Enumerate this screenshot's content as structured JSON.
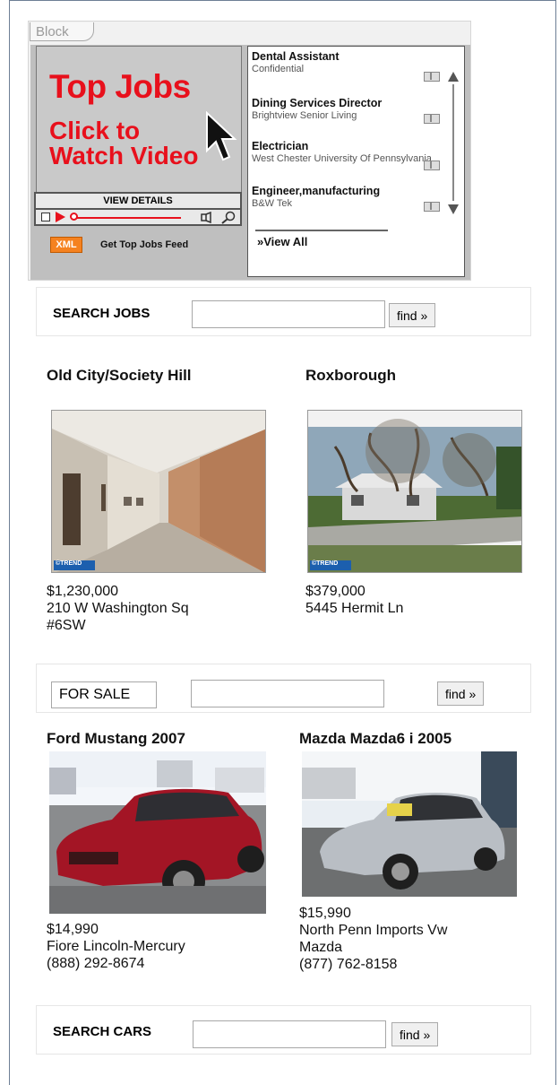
{
  "block_tab": "Block",
  "top_jobs": {
    "video_title": "Top Jobs",
    "video_subtitle_1": "Click to",
    "video_subtitle_2": "Watch Video",
    "view_details": "VIEW DETAILS",
    "xml_badge": "XML",
    "feed_label": "Get Top Jobs Feed",
    "view_all": "»View All",
    "jobs": [
      {
        "title": "Dental Assistant",
        "company": "Confidential"
      },
      {
        "title": "Dining Services Director",
        "company": "Brightview Senior Living"
      },
      {
        "title": "Electrician",
        "company": "West Chester University Of Pennsylvania"
      },
      {
        "title": "Engineer,manufacturing",
        "company": "B&W Tek"
      }
    ]
  },
  "search_jobs": {
    "label": "SEARCH JOBS",
    "value": "",
    "button": "find »"
  },
  "homes": [
    {
      "heading": "Old City/Society Hill",
      "price": "$1,230,000",
      "address_1": "210 W Washington Sq",
      "address_2": "#6SW",
      "watermark": "©TREND"
    },
    {
      "heading": "Roxborough",
      "price": "$379,000",
      "address_1": "5445 Hermit Ln",
      "address_2": "",
      "watermark": "©TREND"
    }
  ],
  "search_homes": {
    "select_value": "FOR SALE",
    "value": "",
    "button": "find »"
  },
  "cars": [
    {
      "heading": "Ford Mustang 2007",
      "price": "$14,990",
      "dealer_1": "Fiore Lincoln-Mercury",
      "dealer_2": "",
      "phone": "(888) 292-8674"
    },
    {
      "heading": "Mazda Mazda6 i 2005",
      "price": "$15,990",
      "dealer_1": "North Penn Imports Vw",
      "dealer_2": "Mazda",
      "phone": "(877) 762-8158"
    }
  ],
  "search_cars": {
    "label": "SEARCH CARS",
    "value": "",
    "button": "find »"
  },
  "colors": {
    "accent_red": "#e8101c",
    "xml_orange": "#f58220",
    "frame_border": "#6d7f95",
    "car_red": "#a31525",
    "car_silver": "#b9bec4"
  }
}
